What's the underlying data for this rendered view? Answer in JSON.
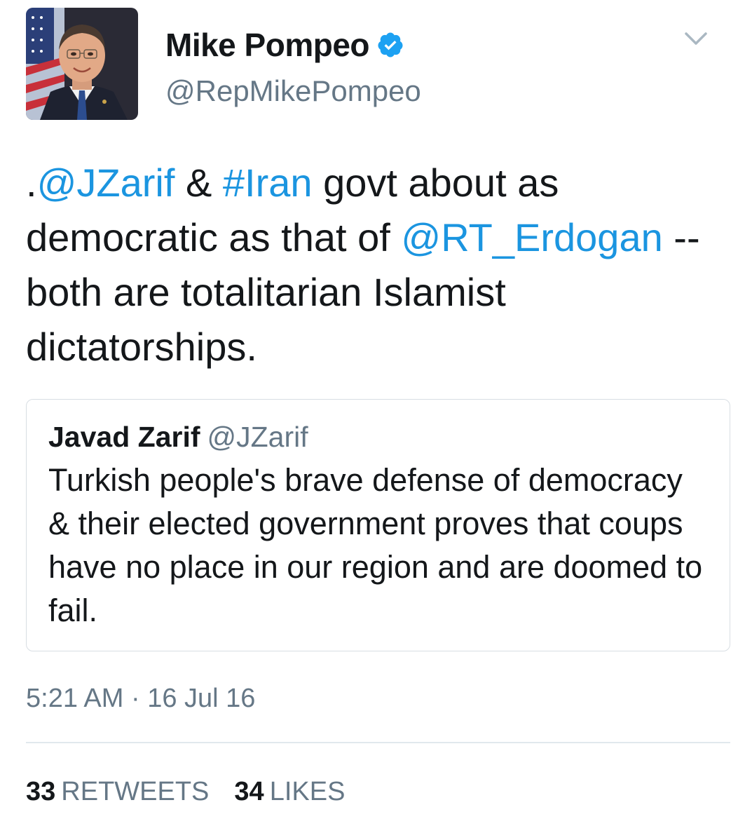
{
  "author": {
    "display_name": "Mike Pompeo",
    "handle": "@RepMikePompeo",
    "verified": true
  },
  "tweet": {
    "segments": [
      {
        "text": ".",
        "type": "text"
      },
      {
        "text": "@JZarif",
        "type": "mention"
      },
      {
        "text": " & ",
        "type": "text"
      },
      {
        "text": "#Iran",
        "type": "hashtag"
      },
      {
        "text": " govt about as democratic as that of ",
        "type": "text"
      },
      {
        "text": "@RT_Erdogan",
        "type": "mention"
      },
      {
        "text": " -- both are totalitarian Islamist dictatorships.",
        "type": "text"
      }
    ]
  },
  "quoted_tweet": {
    "display_name": "Javad Zarif",
    "handle": "@JZarif",
    "text": "Turkish people's brave defense of democracy & their elected government proves that coups have no place in our region and are doomed to fail."
  },
  "timestamp": "5:21 AM · 16 Jul 16",
  "stats": {
    "retweets_count": "33",
    "retweets_label": "RETWEETS",
    "likes_count": "34",
    "likes_label": "LIKES"
  },
  "icons": {
    "verified": "verified-badge-icon",
    "caret": "chevron-down-icon"
  },
  "colors": {
    "link": "#1b95e0",
    "secondary_text": "#657786",
    "primary_text": "#14171a",
    "border": "#d8dee3"
  }
}
